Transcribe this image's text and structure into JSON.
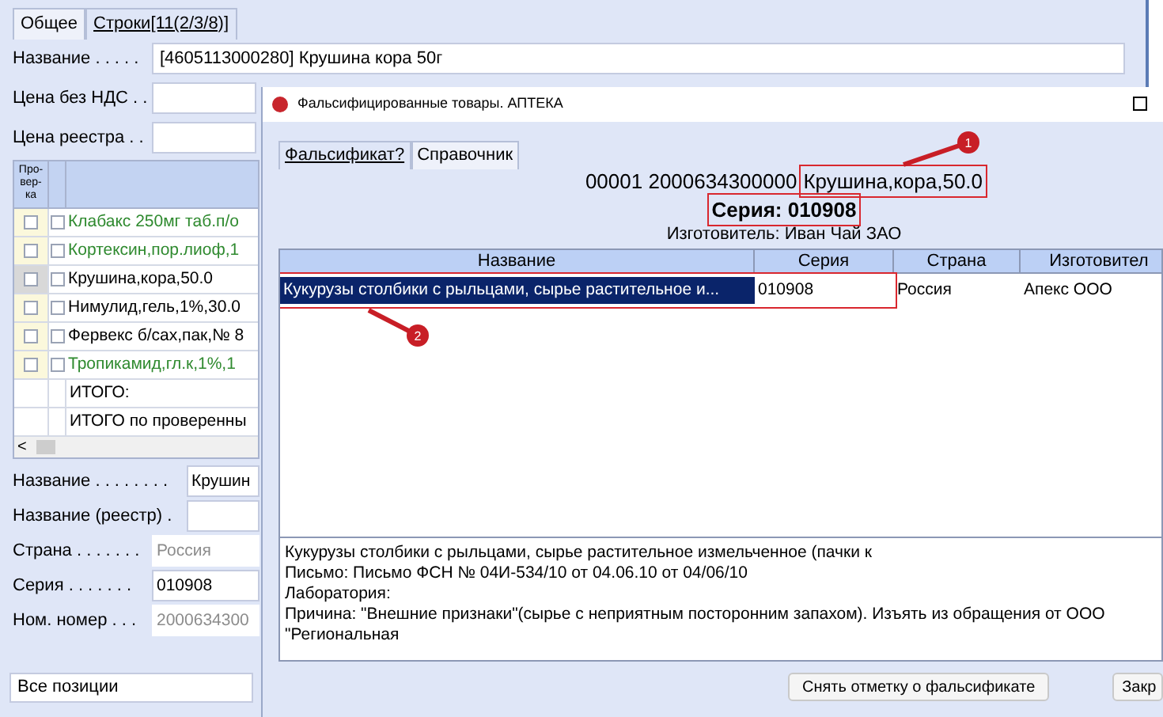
{
  "main_form": {
    "tabs": [
      {
        "label": "Общее",
        "selected": false
      },
      {
        "label": "Строки[11(2/3/8)]",
        "selected": true
      }
    ],
    "top_fields": [
      {
        "label": "Название . . . . .",
        "value": "[4605113000280] Крушина кора 50г"
      },
      {
        "label": "Цена без НДС . ."
      },
      {
        "label": "Цена реестра . ."
      }
    ],
    "grid": {
      "check_header": "Про-\nвер-\nка",
      "rows": [
        {
          "name": "Клабакс 250мг таб.п/о",
          "color": "#2f8a2f",
          "selected": false,
          "verified": false,
          "checked": false
        },
        {
          "name": "Кортексин,пор.лиоф,1",
          "color": "#2f8a2f",
          "selected": false,
          "verified": false,
          "checked": false
        },
        {
          "name": "Крушина,кора,50.0",
          "color": "#000000",
          "selected": true,
          "verified": false,
          "checked": false
        },
        {
          "name": "Нимулид,гель,1%,30.0",
          "color": "#000000",
          "selected": false,
          "verified": false,
          "checked": false
        },
        {
          "name": "Фервекс б/сах,пак,№ 8",
          "color": "#000000",
          "selected": false,
          "verified": false,
          "checked": false
        },
        {
          "name": "Тропикамид,гл.к,1%,1",
          "color": "#2f8a2f",
          "selected": false,
          "verified": false,
          "checked": false
        }
      ],
      "totals": [
        "ИТОГО:",
        "ИТОГО по проверенны"
      ],
      "scroll_left": "<"
    },
    "detail_fields": [
      {
        "label": "Название . . . . . . . .",
        "value": "Крушин",
        "disabled": false
      },
      {
        "label": "Название (реестр) .",
        "disabled": false
      },
      {
        "label": "Страна . . . . . . .",
        "value": "Россия",
        "disabled": true
      },
      {
        "label": "Серия . . . . . . .",
        "value": "010908",
        "disabled": false
      },
      {
        "label": "Ном. номер . . .",
        "value": "2000634300",
        "disabled": true
      }
    ],
    "filter": {
      "value": "Все позиции"
    }
  },
  "dialog": {
    "title": "Фальсифицированные товары. АПТЕКА",
    "tabs": [
      {
        "label": "Фальсификат?",
        "selected": true
      },
      {
        "label": "Справочник",
        "selected": false
      }
    ],
    "header": {
      "code": "00001 2000634300000",
      "product": "Крушина,кора,50.0",
      "series": "Серия: 010908",
      "manufacturer": "Изготовитель: Иван Чай ЗАО"
    },
    "table": {
      "columns": [
        "Название",
        "Серия",
        "Страна",
        "Изготовител"
      ],
      "rows": [
        {
          "cells": [
            "Кукурузы столбики с рыльцами, сырье растительное и...",
            "010908",
            "Россия",
            "Апекс ООО"
          ],
          "selected": true
        }
      ]
    },
    "details": [
      "Кукурузы столбики с рыльцами, сырье растительное измельченное (пачки к",
      "Письмо: Письмо ФСН № 04И-534/10 от 04.06.10 от 04/06/10",
      "Лаборатория:",
      "Причина: \"Внешние признаки\"(сырье с неприятным посторонним запахом). Изъять из обращения от ООО",
      "\"Региональная"
    ],
    "buttons": [
      "Снять отметку о фальсификате",
      "Закр"
    ]
  },
  "callouts": [
    {
      "number": "1"
    },
    {
      "number": "2"
    }
  ]
}
